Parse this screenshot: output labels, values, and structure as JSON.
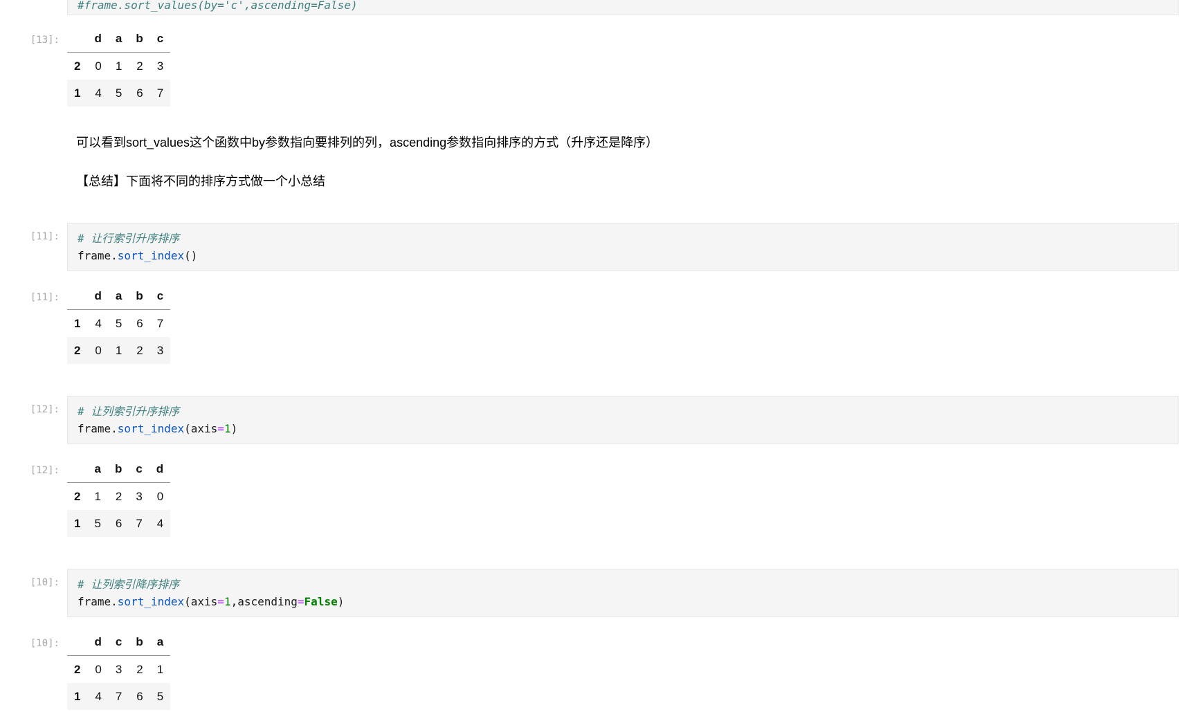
{
  "syntax_colors": {
    "comment": "#408080",
    "property": "#0a55c0",
    "operator": "#aa22ff",
    "number": "#008000",
    "keyword": "#008000"
  },
  "colors": {
    "cell_background": "#f5f5f5",
    "cell_border": "#e6e6e6",
    "prompt_text": "#a6a6a6",
    "table_alt_row": "#f5f5f5"
  },
  "notebook": {
    "top_cell": {
      "code": "#frame.sort_values(by='c',ascending=False)"
    },
    "out13": {
      "prompt": "[13]:",
      "table": {
        "columns": [
          "d",
          "a",
          "b",
          "c"
        ],
        "rows": [
          {
            "index": "2",
            "values": [
              "0",
              "1",
              "2",
              "3"
            ]
          },
          {
            "index": "1",
            "values": [
              "4",
              "5",
              "6",
              "7"
            ]
          }
        ]
      }
    },
    "md1": {
      "text": "可以看到sort_values这个函数中by参数指向要排列的列，ascending参数指向排序的方式（升序还是降序）"
    },
    "md2": {
      "text": "【总结】下面将不同的排序方式做一个小总结"
    },
    "in11": {
      "prompt": "[11]:",
      "comment": "# 让行索引升序排序",
      "tokens": [
        {
          "t": "frame."
        },
        {
          "t": "sort_index"
        },
        {
          "t": "()"
        }
      ]
    },
    "out11": {
      "prompt": "[11]:",
      "table": {
        "columns": [
          "d",
          "a",
          "b",
          "c"
        ],
        "rows": [
          {
            "index": "1",
            "values": [
              "4",
              "5",
              "6",
              "7"
            ]
          },
          {
            "index": "2",
            "values": [
              "0",
              "1",
              "2",
              "3"
            ]
          }
        ]
      }
    },
    "in12": {
      "prompt": "[12]:",
      "comment": "# 让列索引升序排序",
      "tokens": [
        {
          "t": "frame."
        },
        {
          "t": "sort_index"
        },
        {
          "t": "(axis"
        },
        {
          "t": "="
        },
        {
          "t": "1"
        },
        {
          "t": ")"
        }
      ]
    },
    "out12": {
      "prompt": "[12]:",
      "table": {
        "columns": [
          "a",
          "b",
          "c",
          "d"
        ],
        "rows": [
          {
            "index": "2",
            "values": [
              "1",
              "2",
              "3",
              "0"
            ]
          },
          {
            "index": "1",
            "values": [
              "5",
              "6",
              "7",
              "4"
            ]
          }
        ]
      }
    },
    "in10": {
      "prompt": "[10]:",
      "comment": "# 让列索引降序排序",
      "tokens": [
        {
          "t": "frame."
        },
        {
          "t": "sort_index"
        },
        {
          "t": "(axis"
        },
        {
          "t": "="
        },
        {
          "t": "1"
        },
        {
          "t": ",ascending"
        },
        {
          "t": "="
        },
        {
          "t": "False"
        },
        {
          "t": ")"
        }
      ]
    },
    "out10": {
      "prompt": "[10]:",
      "table": {
        "columns": [
          "d",
          "c",
          "b",
          "a"
        ],
        "rows": [
          {
            "index": "2",
            "values": [
              "0",
              "3",
              "2",
              "1"
            ]
          },
          {
            "index": "1",
            "values": [
              "4",
              "7",
              "6",
              "5"
            ]
          }
        ]
      }
    }
  }
}
